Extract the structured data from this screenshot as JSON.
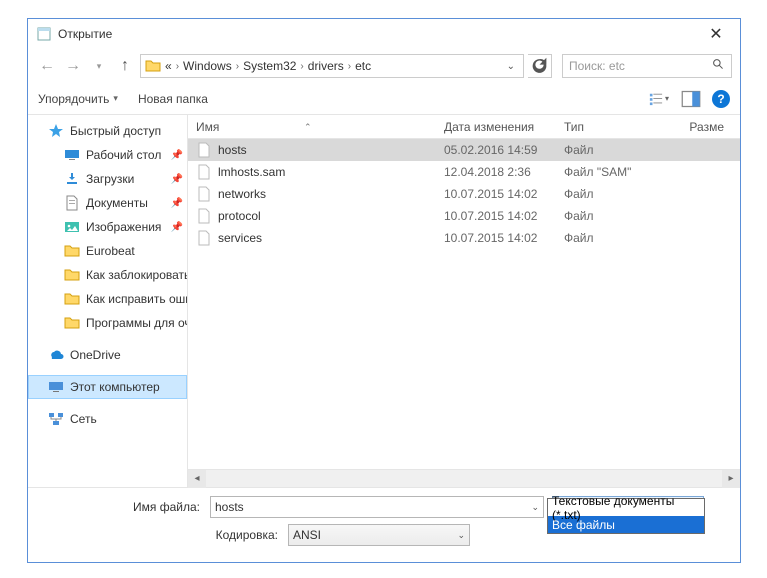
{
  "title": "Открытие",
  "breadcrumb": {
    "root": "«",
    "p1": "Windows",
    "p2": "System32",
    "p3": "drivers",
    "p4": "etc"
  },
  "search": {
    "placeholder": "Поиск: etc"
  },
  "toolbar": {
    "organize": "Упорядочить",
    "new_folder": "Новая папка"
  },
  "columns": {
    "name": "Имя",
    "date": "Дата изменения",
    "type": "Тип",
    "size": "Разме"
  },
  "sidebar": {
    "quick": "Быстрый доступ",
    "desktop": "Рабочий стол",
    "downloads": "Загрузки",
    "documents": "Документы",
    "pictures": "Изображения",
    "f1": "Eurobeat",
    "f2": "Как заблокировать",
    "f3": "Как исправить оши",
    "f4": "Программы для оч",
    "onedrive": "OneDrive",
    "thispc": "Этот компьютер",
    "network": "Сеть"
  },
  "files": [
    {
      "name": "hosts",
      "date": "05.02.2016 14:59",
      "type": "Файл"
    },
    {
      "name": "lmhosts.sam",
      "date": "12.04.2018 2:36",
      "type": "Файл \"SAM\""
    },
    {
      "name": "networks",
      "date": "10.07.2015 14:02",
      "type": "Файл"
    },
    {
      "name": "protocol",
      "date": "10.07.2015 14:02",
      "type": "Файл"
    },
    {
      "name": "services",
      "date": "10.07.2015 14:02",
      "type": "Файл"
    }
  ],
  "bottom": {
    "filename_label": "Имя файла:",
    "filename_value": "hosts",
    "filter_value": "Все файлы",
    "encoding_label": "Кодировка:",
    "encoding_value": "ANSI",
    "filter_options": {
      "o1": "Текстовые документы (*.txt)",
      "o2": "Все файлы"
    }
  }
}
